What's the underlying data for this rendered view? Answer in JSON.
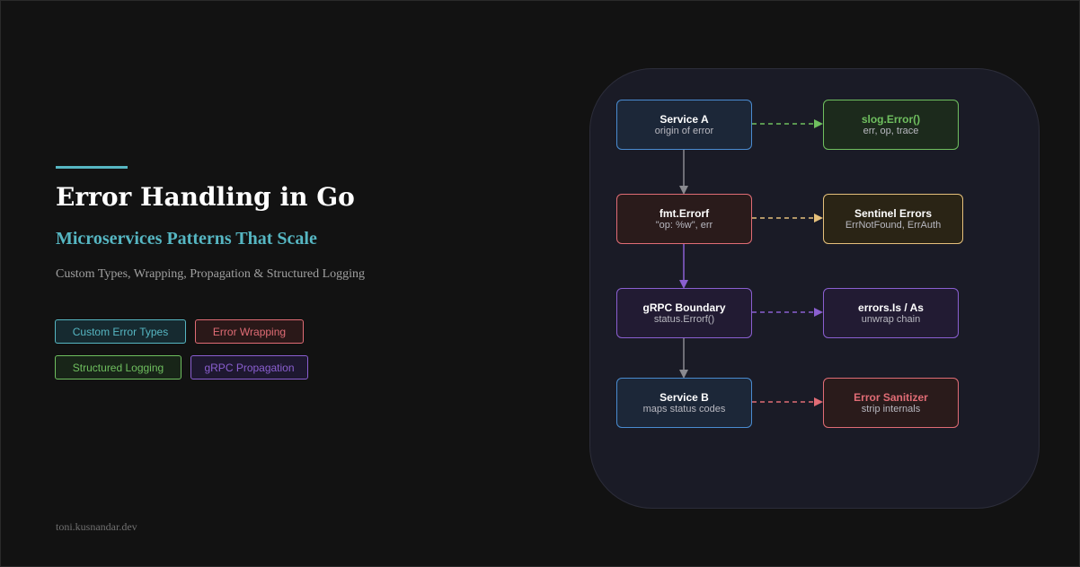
{
  "hero": {
    "title": "Error Handling in Go",
    "subtitle": "Microservices Patterns That Scale",
    "description": "Custom Types, Wrapping, Propagation & Structured Logging",
    "accent_color": "#56b6c2"
  },
  "tags": [
    {
      "label": "Custom Error Types",
      "color": "#56b6c2"
    },
    {
      "label": "Error Wrapping",
      "color": "#e06c75"
    },
    {
      "label": "Structured Logging",
      "color": "#6fbf5f"
    },
    {
      "label": "gRPC Propagation",
      "color": "#8a5fd0"
    }
  ],
  "footer": {
    "text": "toni.kusnandar.dev"
  },
  "diagram": {
    "main_flow": [
      {
        "title": "Service A",
        "subtitle": "origin of error",
        "color": "#4a8bd0"
      },
      {
        "title": "fmt.Errorf",
        "subtitle": "\"op: %w\", err",
        "color": "#e06c75"
      },
      {
        "title": "gRPC Boundary",
        "subtitle": "status.Errorf()",
        "color": "#8a5fd0"
      },
      {
        "title": "Service B",
        "subtitle": "maps status codes",
        "color": "#4a8bd0"
      }
    ],
    "side_nodes": [
      {
        "title": "slog.Error()",
        "subtitle": "err, op, trace",
        "color": "#6fbf5f"
      },
      {
        "title": "Sentinel Errors",
        "subtitle": "ErrNotFound, ErrAuth",
        "color": "#e5c07b"
      },
      {
        "title": "errors.Is / As",
        "subtitle": "unwrap chain",
        "color": "#8a5fd0"
      },
      {
        "title": "Error Sanitizer",
        "subtitle": "strip internals",
        "color": "#e06c75"
      }
    ]
  }
}
